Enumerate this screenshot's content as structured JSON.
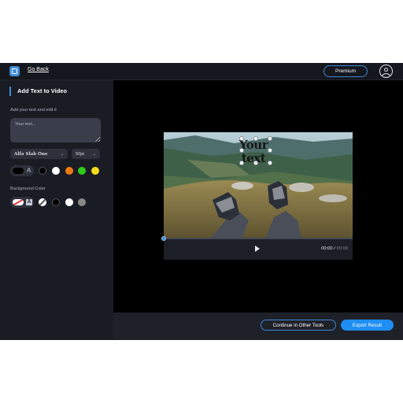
{
  "topbar": {
    "back_label": "Go Back",
    "premium_label": "Premium",
    "icons": [
      "app-logo-icon",
      "user-avatar-icon"
    ]
  },
  "sidebar": {
    "title": "Add Text to Video",
    "text_label": "Add your text and edit it",
    "text_placeholder": "Your text...",
    "text_value": "",
    "font": "Alfa Slab One",
    "size": "50pt",
    "text_colors": [
      "#000000",
      "#ffffff",
      "#f07a12",
      "#2ecc1a",
      "#f5dc1b"
    ],
    "background_label": "Background Color",
    "background_colors": [
      "none",
      "#000000",
      "#ffffff",
      "#888888"
    ],
    "toggle_glyph": "A"
  },
  "video": {
    "overlay_text": "Your text",
    "current_time": "00:00",
    "separator": " / ",
    "total_time": "00:08",
    "progress": 0
  },
  "footer": {
    "continue_label": "Continue in Other Tools",
    "export_label": "Export Result"
  }
}
